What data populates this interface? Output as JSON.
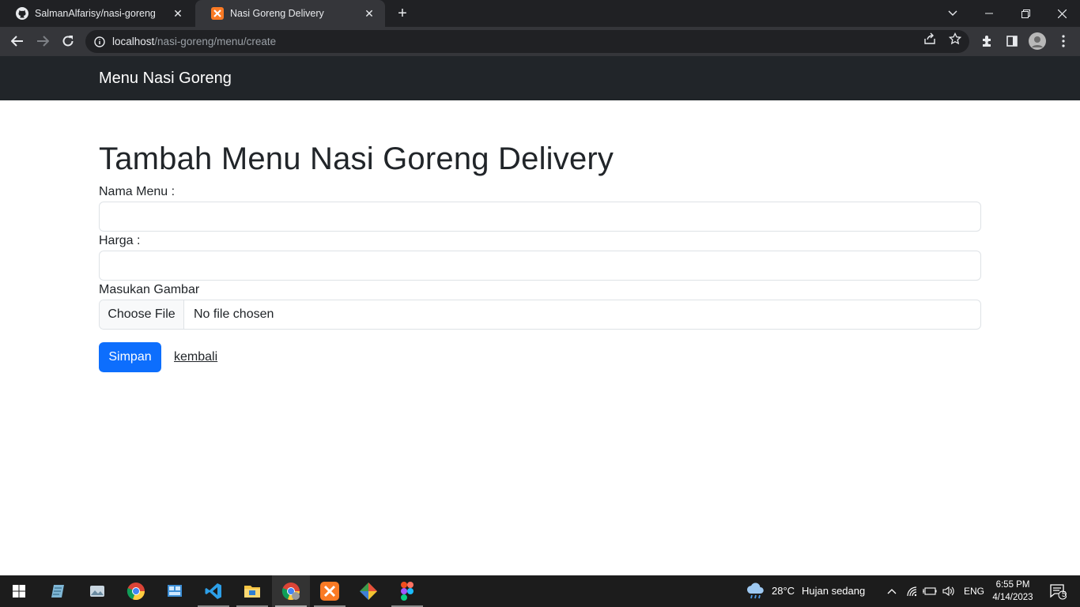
{
  "browser": {
    "tabs": [
      {
        "title": "SalmanAlfarisy/nasi-goreng",
        "favicon": "github-icon",
        "active": false
      },
      {
        "title": "Nasi Goreng Delivery",
        "favicon": "xampp-icon",
        "active": true
      }
    ],
    "url": {
      "host": "localhost",
      "path": "/nasi-goreng/menu/create"
    }
  },
  "navbar": {
    "brand": "Menu Nasi Goreng"
  },
  "page": {
    "heading": "Tambah Menu Nasi Goreng Delivery",
    "fields": {
      "nama_label": "Nama Menu :",
      "nama_value": "",
      "harga_label": "Harga :",
      "harga_value": "",
      "gambar_label": "Masukan Gambar",
      "file_button": "Choose File",
      "file_status": "No file chosen"
    },
    "submit_label": "Simpan",
    "back_link": "kembali"
  },
  "colors": {
    "primary": "#0d6efd",
    "navbar": "#212529",
    "chrome_dark": "#202124"
  },
  "taskbar": {
    "apps": [
      "windows-start-icon",
      "notepad-icon",
      "photos-icon",
      "chrome-icon",
      "control-panel-icon",
      "vscode-icon",
      "file-explorer-icon",
      "chrome-profile-icon",
      "xampp-icon",
      "git-icon",
      "figma-icon"
    ],
    "weather": {
      "temp": "28°C",
      "desc": "Hujan sedang"
    },
    "language": "ENG",
    "time": "6:55 PM",
    "date": "4/14/2023",
    "notifications": "5"
  }
}
